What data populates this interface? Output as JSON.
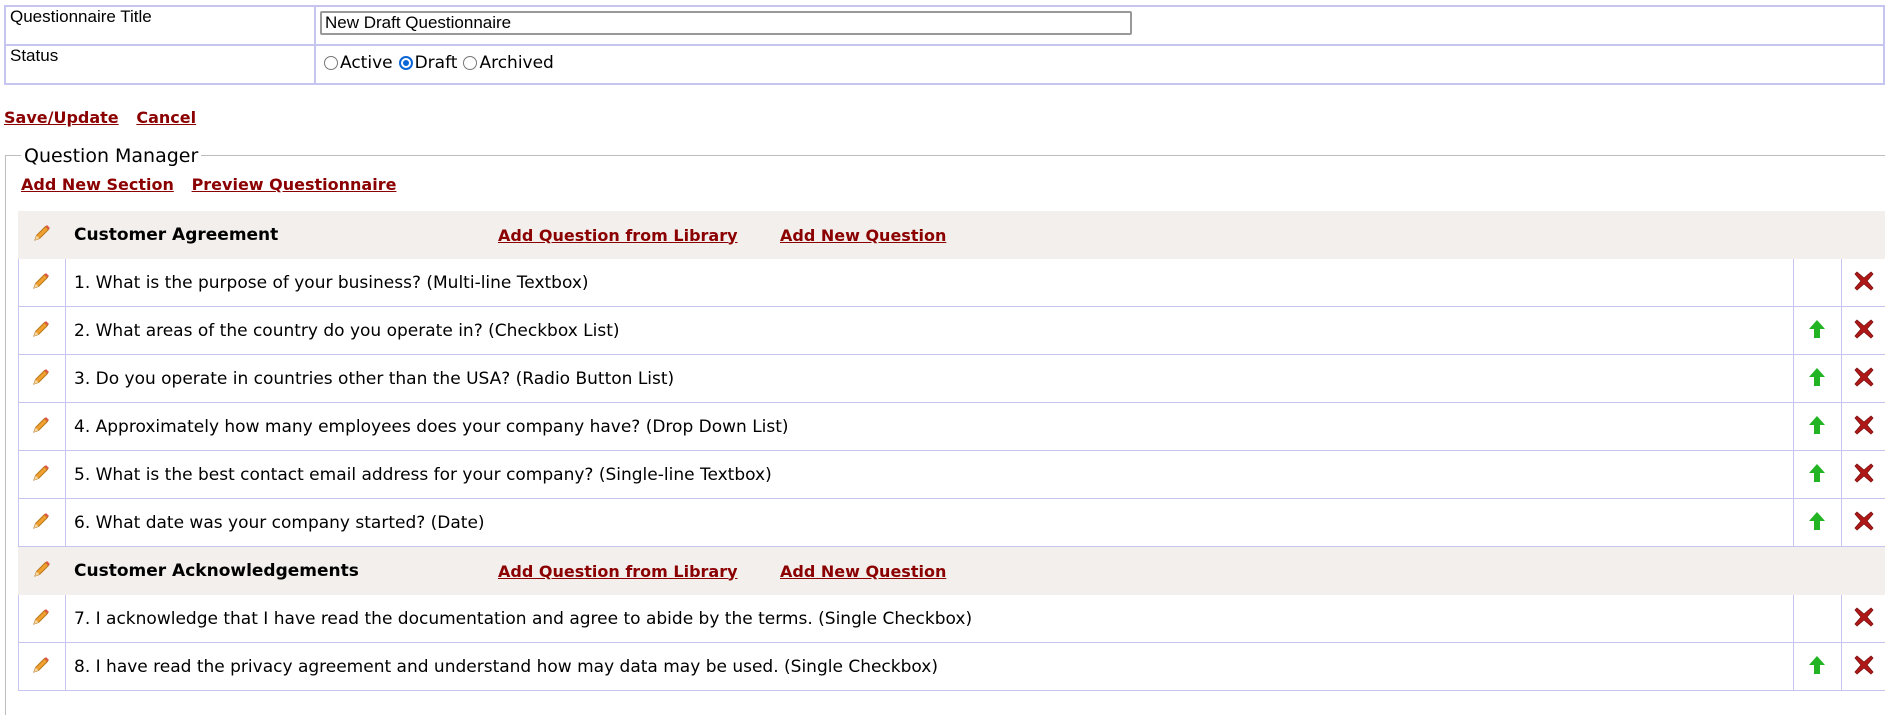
{
  "form": {
    "title_label": "Questionnaire Title",
    "title_value": "New Draft Questionnaire",
    "status_label": "Status",
    "status_options": [
      "Active",
      "Draft",
      "Archived"
    ],
    "status_selected": "Draft"
  },
  "actions": {
    "save_label": "Save/Update",
    "cancel_label": "Cancel"
  },
  "question_manager": {
    "legend": "Question Manager",
    "add_section_label": "Add New Section",
    "preview_label": "Preview Questionnaire",
    "sections": [
      {
        "title": "Customer Agreement",
        "add_from_library": "Add Question from Library",
        "add_new_question": "Add New Question",
        "questions": [
          {
            "text": "1. What is the purpose of your business? (Multi-line Textbox)",
            "can_move_up": false
          },
          {
            "text": "2. What areas of the country do you operate in? (Checkbox List)",
            "can_move_up": true
          },
          {
            "text": "3. Do you operate in countries other than the USA? (Radio Button List)",
            "can_move_up": true
          },
          {
            "text": "4. Approximately how many employees does your company have? (Drop Down List)",
            "can_move_up": true
          },
          {
            "text": "5. What is the best contact email address for your company? (Single-line Textbox)",
            "can_move_up": true
          },
          {
            "text": "6. What date was your company started? (Date)",
            "can_move_up": true
          }
        ]
      },
      {
        "title": "Customer Acknowledgements",
        "add_from_library": "Add Question from Library",
        "add_new_question": "Add New Question",
        "questions": [
          {
            "text": "7. I acknowledge that I have read the documentation and agree to abide by the terms. (Single Checkbox)",
            "can_move_up": false
          },
          {
            "text": "8. I have read the privacy agreement and understand how may data may be used. (Single Checkbox)",
            "can_move_up": true
          }
        ]
      }
    ]
  },
  "colors": {
    "link": "#8b0000",
    "border": "#c5c5ef",
    "section_bg": "#f2efed",
    "pencil": "#f0a030",
    "up_arrow": "#22b422",
    "delete": "#b01818"
  },
  "icons": {
    "edit": "pencil-icon",
    "move_up": "arrow-up-icon",
    "delete": "delete-x-icon"
  }
}
